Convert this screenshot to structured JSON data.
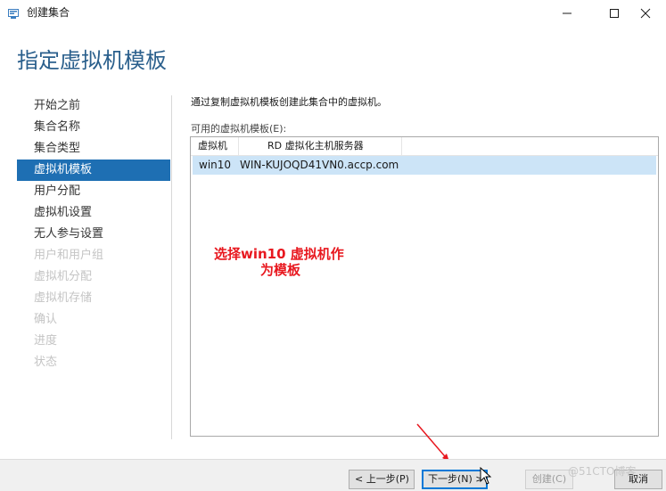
{
  "window": {
    "title": "创建集合",
    "minimize_icon": "minimize-icon",
    "maximize_icon": "maximize-icon",
    "close_icon": "close-icon"
  },
  "page": {
    "title": "指定虚拟机模板"
  },
  "sidebar": {
    "items": [
      {
        "label": "开始之前",
        "state": "normal"
      },
      {
        "label": "集合名称",
        "state": "normal"
      },
      {
        "label": "集合类型",
        "state": "normal"
      },
      {
        "label": "虚拟机模板",
        "state": "active"
      },
      {
        "label": "用户分配",
        "state": "normal"
      },
      {
        "label": "虚拟机设置",
        "state": "normal"
      },
      {
        "label": "无人参与设置",
        "state": "normal"
      },
      {
        "label": "用户和用户组",
        "state": "disabled"
      },
      {
        "label": "虚拟机分配",
        "state": "disabled"
      },
      {
        "label": "虚拟机存储",
        "state": "disabled"
      },
      {
        "label": "确认",
        "state": "disabled"
      },
      {
        "label": "进度",
        "state": "disabled"
      },
      {
        "label": "状态",
        "state": "disabled"
      }
    ]
  },
  "main": {
    "description": "通过复制虚拟机模板创建此集合中的虚拟机。",
    "list_label": "可用的虚拟机模板(E):",
    "columns": [
      "虚拟机",
      "RD 虚拟化主机服务器"
    ],
    "rows": [
      {
        "vm": "win10",
        "host": "WIN-KUJOQD41VN0.accp.com",
        "selected": true
      }
    ]
  },
  "annotation": {
    "line1": "选择win10 虚拟机作",
    "line2": "为模板",
    "color": "#e8181f"
  },
  "footer": {
    "prev_label": "< 上一步(P)",
    "next_label": "下一步(N) >",
    "create_label": "创建(C)",
    "cancel_label": "取消"
  },
  "watermark": "@51CTO博客",
  "colors": {
    "accent": "#1e6fb3",
    "title": "#2a5f8c",
    "selection": "#cce4f7"
  }
}
